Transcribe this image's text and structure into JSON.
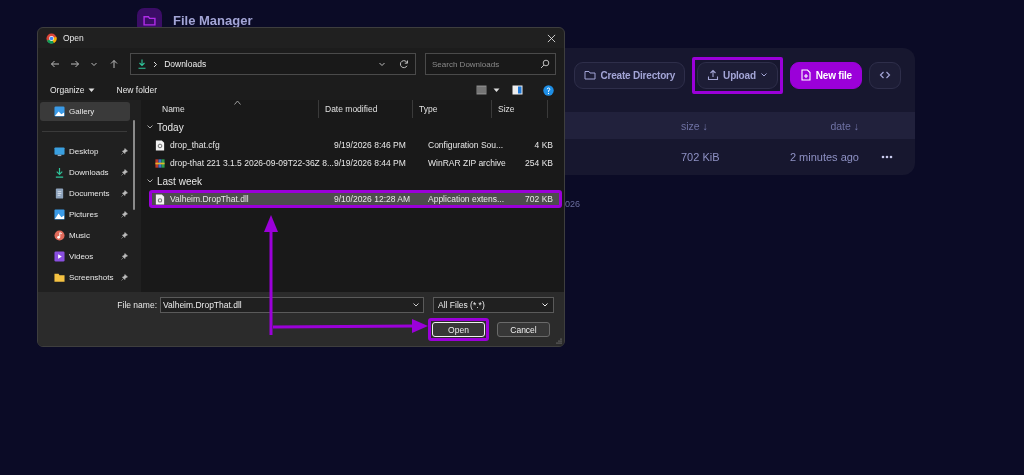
{
  "app": {
    "title": "File Manager",
    "toolbar": [
      {
        "label": "Create Directory",
        "kind": "create-directory",
        "primary": false,
        "highlighted": false
      },
      {
        "label": "Upload",
        "kind": "upload",
        "primary": false,
        "highlighted": true
      },
      {
        "label": "New file",
        "kind": "new-file",
        "primary": true,
        "highlighted": false
      },
      {
        "kind": "code",
        "primary": false,
        "highlighted": false
      }
    ],
    "columns": [
      "size ↓",
      "date ↓"
    ],
    "rows": [
      {
        "size": "702 KiB",
        "date": "2 minutes ago"
      }
    ],
    "footer_note": "026"
  },
  "dialog": {
    "title": "Open",
    "address": "Downloads",
    "search_placeholder": "Search Downloads",
    "toolbar": [
      "Organize",
      "New folder"
    ],
    "sidebar": [
      {
        "label": "Gallery",
        "kind": "gallery",
        "selected": true,
        "pinned": false
      },
      {
        "label": "Desktop",
        "kind": "desktop",
        "selected": false,
        "pinned": true
      },
      {
        "label": "Downloads",
        "kind": "downloads",
        "selected": false,
        "pinned": true
      },
      {
        "label": "Documents",
        "kind": "documents",
        "selected": false,
        "pinned": true
      },
      {
        "label": "Pictures",
        "kind": "pictures",
        "selected": false,
        "pinned": true
      },
      {
        "label": "Music",
        "kind": "music",
        "selected": false,
        "pinned": true
      },
      {
        "label": "Videos",
        "kind": "videos",
        "selected": false,
        "pinned": true
      },
      {
        "label": "Screenshots",
        "kind": "folder",
        "selected": false,
        "pinned": true
      }
    ],
    "columns": [
      "Name",
      "Date modified",
      "Type",
      "Size"
    ],
    "groups": [
      {
        "label": "Today",
        "expanded": true,
        "files": [
          {
            "name": "drop_that.cfg",
            "kind": "config",
            "date": "9/19/2026 8:46 PM",
            "type": "Configuration Sou...",
            "size": "4 KB",
            "selected": false,
            "highlighted": false
          },
          {
            "name": "drop-that 221 3.1.5 2026-09-09T22-36Z 8...",
            "kind": "archive",
            "date": "9/19/2026 8:44 PM",
            "type": "WinRAR ZIP archive",
            "size": "254 KB",
            "selected": false,
            "highlighted": false
          }
        ]
      },
      {
        "label": "Last week",
        "expanded": true,
        "files": [
          {
            "name": "Valheim.DropThat.dll",
            "kind": "dll",
            "date": "9/10/2026 12:28 AM",
            "type": "Application extens...",
            "size": "702 KB",
            "selected": true,
            "highlighted": true
          }
        ]
      }
    ],
    "file_name_label": "File name:",
    "file_name": "Valheim.DropThat.dll",
    "file_type": "All Files (*.*)",
    "buttons": [
      {
        "label": "Open",
        "kind": "default",
        "highlighted": true
      },
      {
        "label": "Cancel",
        "kind": "normal",
        "highlighted": false
      }
    ]
  }
}
